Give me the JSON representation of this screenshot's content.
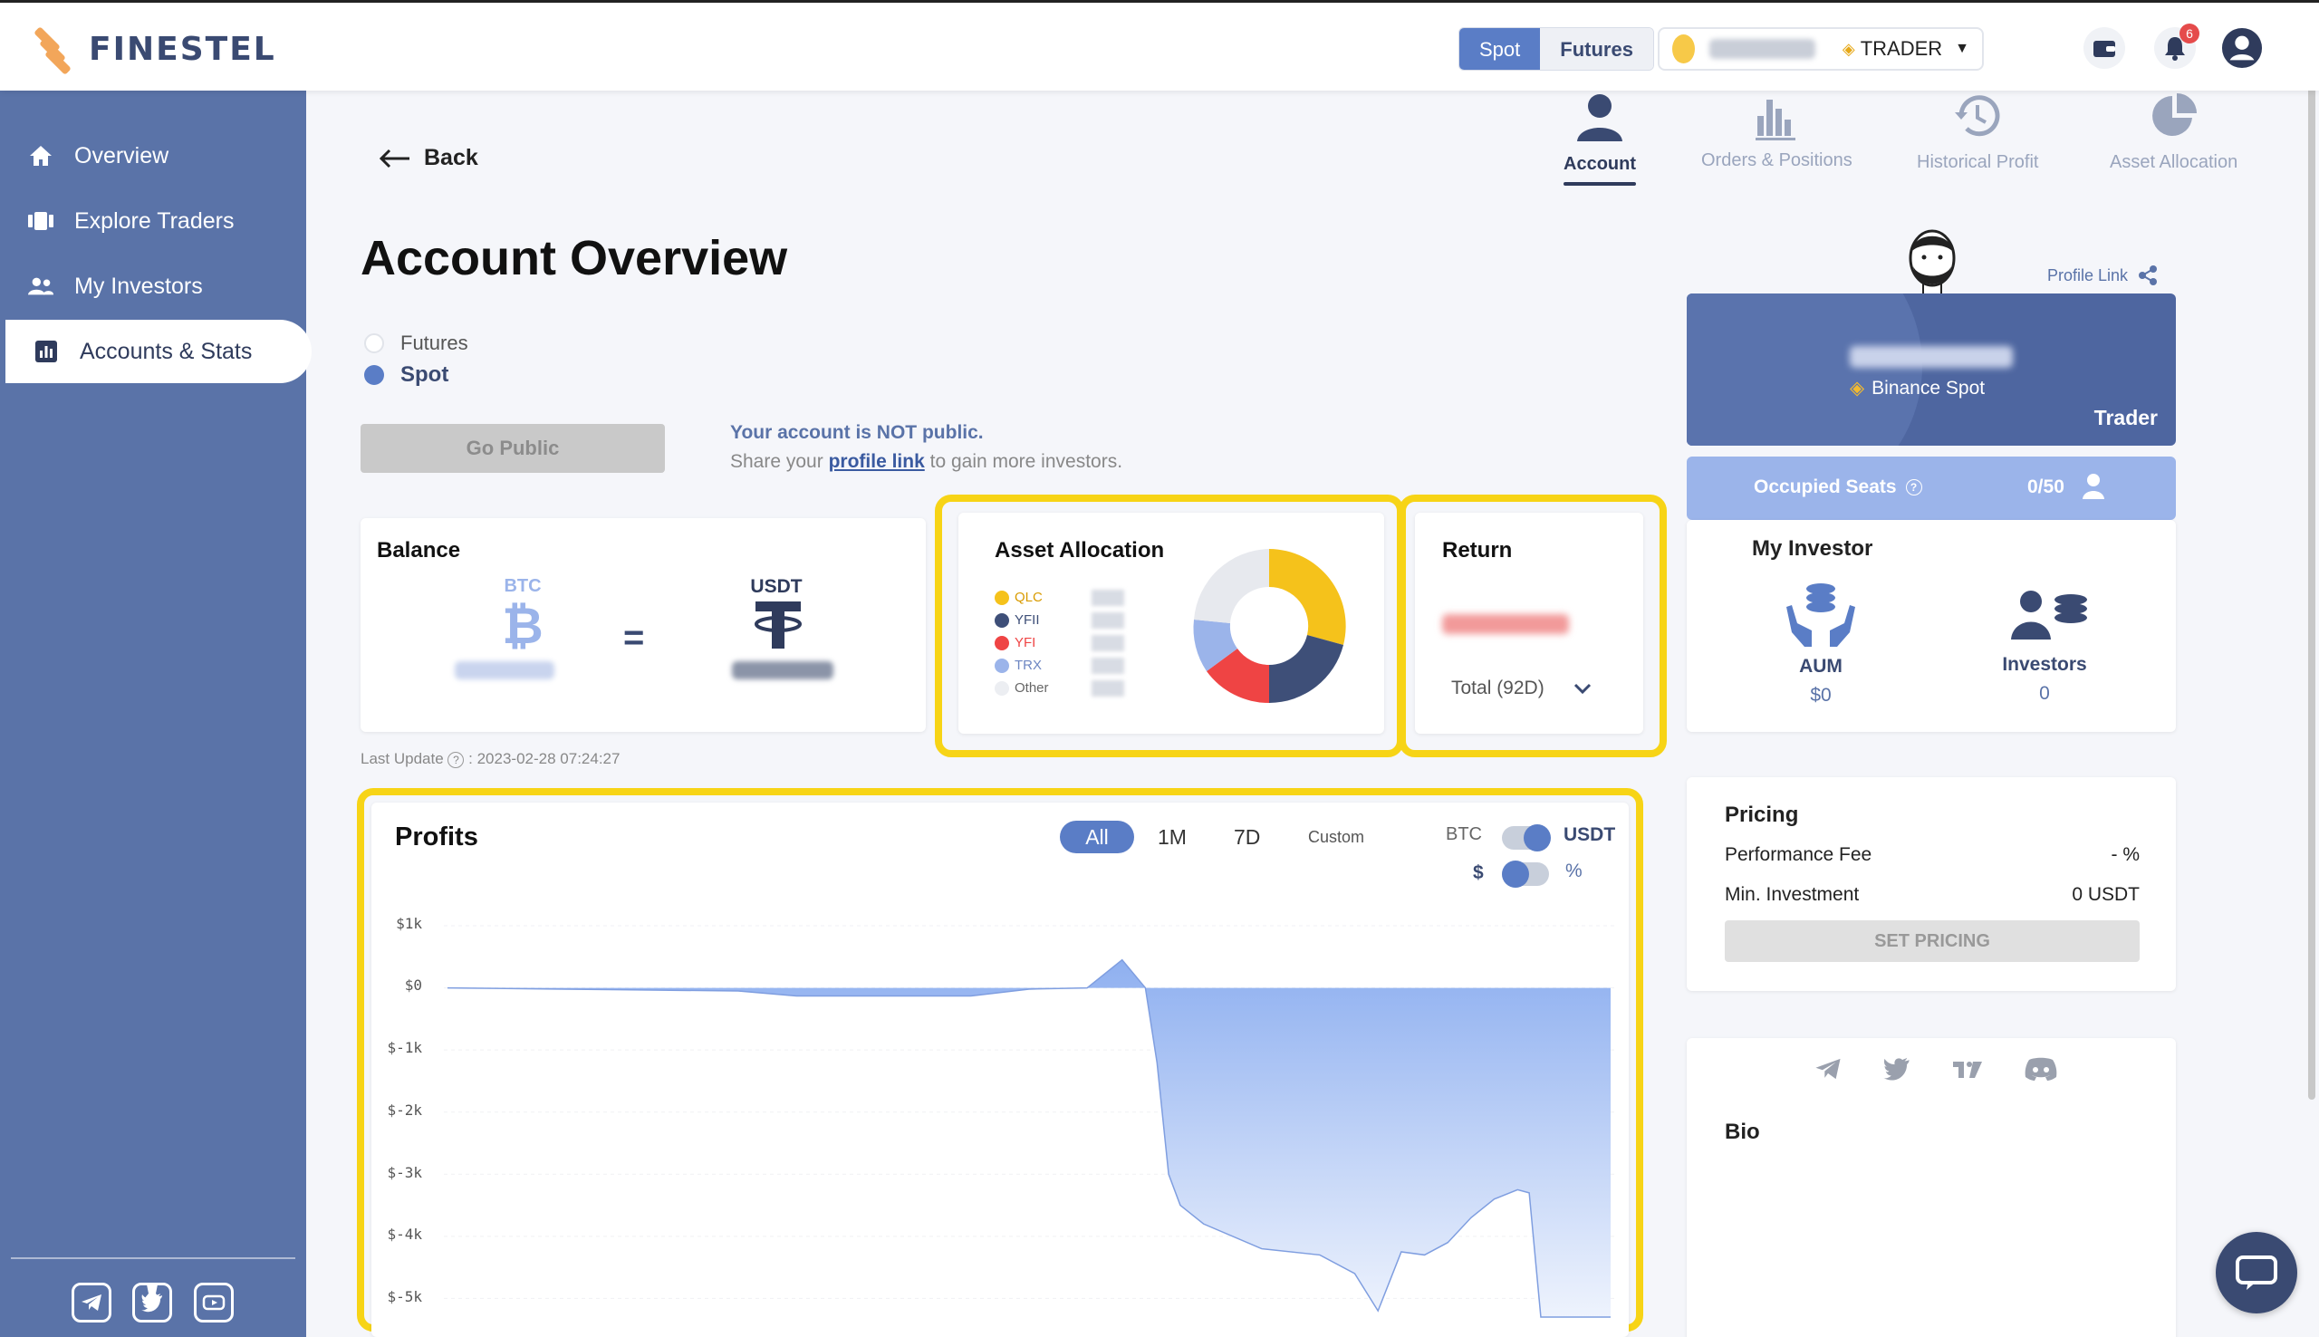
{
  "brand": {
    "name": "FINESTEL"
  },
  "topbar": {
    "segments": [
      "Spot",
      "Futures"
    ],
    "role": "TRADER",
    "notification_count": "6"
  },
  "sidebar": {
    "items": [
      {
        "label": "Overview",
        "icon": "home-icon"
      },
      {
        "label": "Explore Traders",
        "icon": "cards-icon"
      },
      {
        "label": "My Investors",
        "icon": "people-icon"
      },
      {
        "label": "Accounts & Stats",
        "icon": "bar-chart-icon"
      }
    ],
    "social": [
      "telegram-icon",
      "twitter-icon",
      "youtube-icon"
    ]
  },
  "main": {
    "back_label": "Back",
    "title": "Account Overview",
    "account_types": [
      "Futures",
      "Spot"
    ],
    "selected_type": "Spot",
    "go_public_label": "Go Public",
    "not_public_text": "Your account is NOT public.",
    "share_prefix": "Share your",
    "share_link": "profile link",
    "share_suffix": "to gain more investors.",
    "last_update_label": "Last Update",
    "last_update_value": ": 2023-02-28 07:24:27"
  },
  "top_tabs": [
    {
      "label": "Account",
      "icon": "user-icon"
    },
    {
      "label": "Orders & Positions",
      "icon": "bars-icon"
    },
    {
      "label": "Historical Profit",
      "icon": "history-icon"
    },
    {
      "label": "Asset Allocation",
      "icon": "pie-icon"
    }
  ],
  "balance": {
    "title": "Balance",
    "left_currency": "BTC",
    "right_currency": "USDT",
    "equals": "="
  },
  "asset_allocation": {
    "title": "Asset Allocation",
    "legend": [
      {
        "label": "QLC",
        "color": "#f5c21b"
      },
      {
        "label": "YFII",
        "color": "#3e4f78"
      },
      {
        "label": "YFI",
        "color": "#ef4444"
      },
      {
        "label": "TRX",
        "color": "#9bb4ea"
      },
      {
        "label": "Other",
        "color": "#e7e9ee"
      }
    ]
  },
  "return": {
    "title": "Return",
    "period_label": "Total (92D)"
  },
  "profile": {
    "link_label": "Profile Link",
    "exchange": "Binance Spot",
    "role": "Trader",
    "seats_label": "Occupied Seats",
    "seats_value": "0/50"
  },
  "my_investor": {
    "title": "My Investor",
    "aum_label": "AUM",
    "aum_value": "$0",
    "investors_label": "Investors",
    "investors_value": "0"
  },
  "pricing": {
    "title": "Pricing",
    "fee_label": "Performance Fee",
    "fee_value": "- %",
    "min_label": "Min. Investment",
    "min_value": "0 USDT",
    "button_label": "SET PRICING"
  },
  "bio": {
    "title": "Bio"
  },
  "profits": {
    "title": "Profits",
    "ranges": [
      "All",
      "1M",
      "7D",
      "Custom"
    ],
    "selected_range": "All",
    "toggle1": [
      "BTC",
      "USDT"
    ],
    "toggle2": [
      "$",
      "%"
    ]
  },
  "chart_data": {
    "type": "area",
    "title": "Profits",
    "ylim": [
      -5300,
      1000
    ],
    "yticks": [
      "$1k",
      "$0",
      "$-1k",
      "$-2k",
      "$-3k",
      "$-4k",
      "$-5k"
    ],
    "x": [
      0,
      5,
      10,
      15,
      20,
      25,
      30,
      35,
      40,
      45,
      50,
      55,
      58,
      60,
      61,
      62,
      63,
      65,
      70,
      75,
      78,
      80,
      82,
      84,
      86,
      88,
      90,
      92,
      93,
      94,
      100
    ],
    "values": [
      0,
      -10,
      -20,
      -30,
      -40,
      -50,
      -130,
      -130,
      -130,
      -130,
      -20,
      0,
      450,
      0,
      -1200,
      -3000,
      -3500,
      -3800,
      -4200,
      -4300,
      -4600,
      -5200,
      -4250,
      -4300,
      -4100,
      -3700,
      -3400,
      -3250,
      -3300,
      -5300,
      -5300
    ],
    "grid": false,
    "colors": {
      "fill_top": "#8fb0f0",
      "fill_bottom": "#eef3fd",
      "line": "#7f9ee0"
    }
  }
}
